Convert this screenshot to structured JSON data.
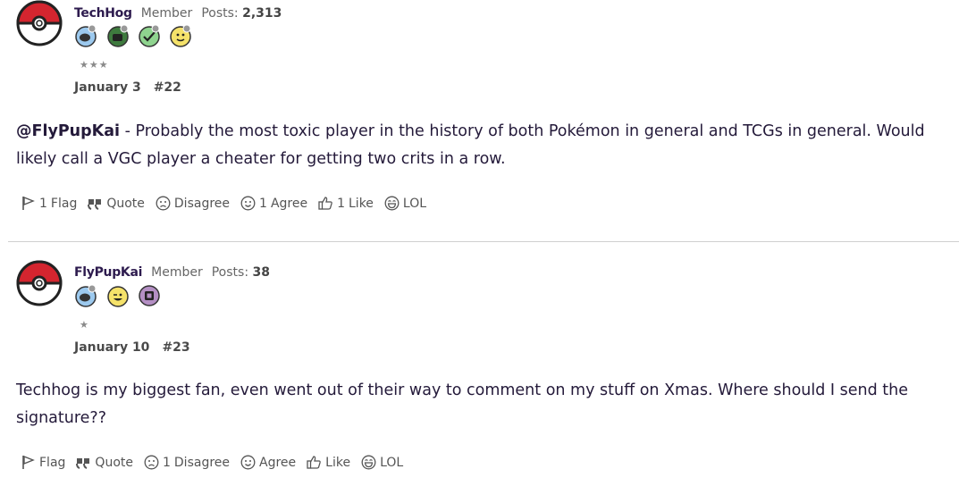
{
  "posts": [
    {
      "username": "TechHog",
      "role": "Member",
      "posts_label": "Posts:",
      "posts_count": "2,313",
      "stars": "★★★",
      "date": "January 3",
      "number": "#22",
      "mention": "@FlyPupKai",
      "text": " - Probably the most toxic player in the history of both Pokémon in general and TCGs in general. Would likely call a VGC player a cheater for getting two crits in a row.",
      "actions": {
        "flag_count": "1",
        "flag": "Flag",
        "quote": "Quote",
        "disagree_count": "",
        "disagree": "Disagree",
        "agree_count": "1",
        "agree": "Agree",
        "like_count": "1",
        "like": "Like",
        "lol": "LOL"
      }
    },
    {
      "username": "FlyPupKai",
      "role": "Member",
      "posts_label": "Posts:",
      "posts_count": "38",
      "stars": "★",
      "date": "January 10",
      "number": "#23",
      "mention": "",
      "text": "Techhog is my biggest fan, even went out of their way to comment on my stuff on Xmas. Where should I send the signature??",
      "actions": {
        "flag_count": "",
        "flag": "Flag",
        "quote": "Quote",
        "disagree_count": "1",
        "disagree": "Disagree",
        "agree_count": "",
        "agree": "Agree",
        "like_count": "",
        "like": "Like",
        "lol": "LOL"
      }
    }
  ],
  "icons": {
    "avatar": "pokeball-icon",
    "flag": "flag-icon",
    "quote": "quote-icon",
    "disagree": "sad-face-icon",
    "agree": "smile-face-icon",
    "like": "thumbs-up-icon",
    "lol": "laugh-face-icon"
  },
  "colors": {
    "text": "#241a3a",
    "username": "#2d1b4e",
    "pokeball_red": "#d4252f",
    "divider": "#cfcfcf"
  }
}
